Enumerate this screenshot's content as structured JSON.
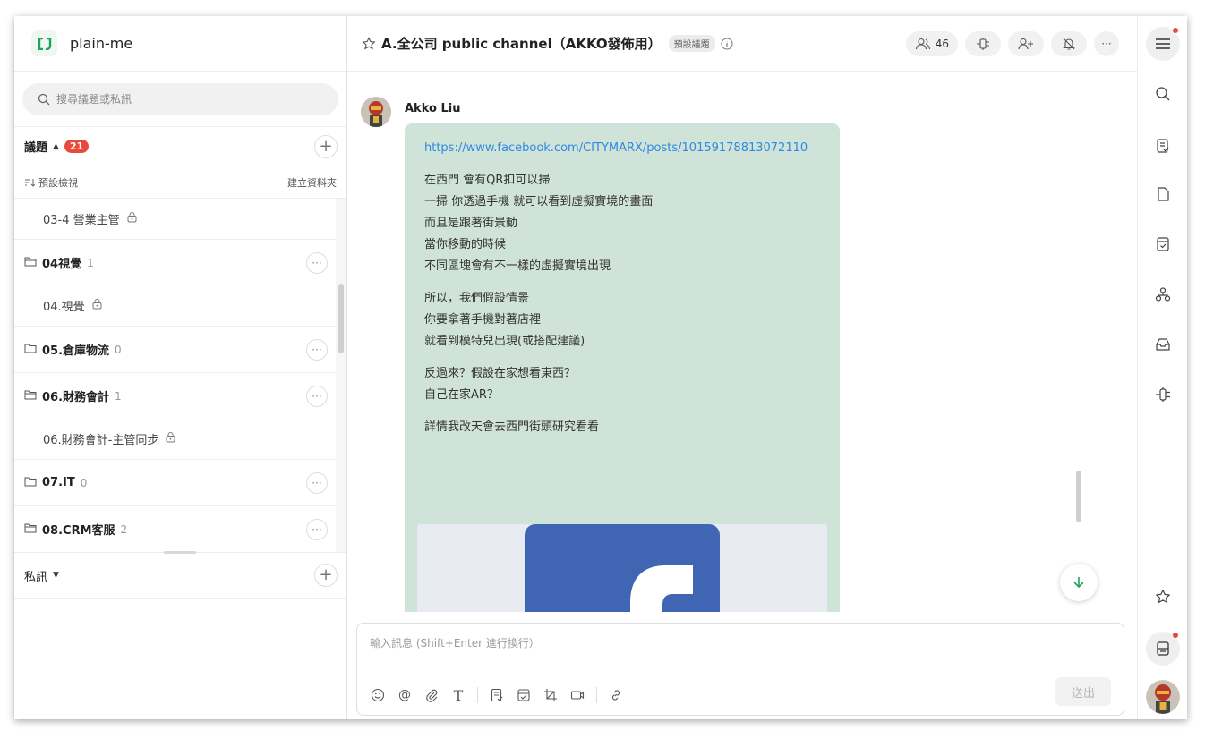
{
  "app": {
    "name": "plain-me"
  },
  "sidebar": {
    "search_placeholder": "搜尋議題或私訊",
    "topics_label": "議題",
    "topics_badge": "21",
    "view_label": "預設檢視",
    "create_folder": "建立資料夾",
    "rows": [
      {
        "type": "child",
        "name": "03-4 營業主管",
        "locked": true
      },
      {
        "type": "folder",
        "name": "04視覺",
        "count": "1",
        "open": true
      },
      {
        "type": "child",
        "name": "04.視覺",
        "locked": true
      },
      {
        "type": "folder",
        "name": "05.倉庫物流",
        "count": "0",
        "open": false
      },
      {
        "type": "folder",
        "name": "06.財務會計",
        "count": "1",
        "open": true
      },
      {
        "type": "child",
        "name": "06.財務會計-主管同步",
        "locked": true
      },
      {
        "type": "folder",
        "name": "07.IT",
        "count": "0",
        "open": false
      },
      {
        "type": "folder",
        "name": "08.CRM客服",
        "count": "2",
        "open": true
      }
    ],
    "dm_label": "私訊"
  },
  "channel": {
    "title": "A.全公司 public channel（AKKO發佈用）",
    "tag": "預設議題",
    "member_count": "46"
  },
  "message": {
    "sender": "Akko Liu",
    "link": "https://www.facebook.com/CITYMARX/posts/10159178813072110",
    "blocks": [
      [
        "在西門 會有QR扣可以掃",
        "一掃 你透過手機 就可以看到虛擬實境的畫面",
        "而且是跟著街景動",
        "當你移動的時候",
        "不同區塊會有不一樣的虛擬實境出現"
      ],
      [
        "所以，我們假設情景",
        "你要拿著手機對著店裡",
        "就看到模特兒出現(或搭配建議)"
      ],
      [
        "反過來？假設在家想看東西？",
        "自己在家AR？"
      ],
      [
        "詳情我改天會去西門街頭研究看看"
      ]
    ]
  },
  "composer": {
    "placeholder": "輸入訊息 (Shift+Enter 進行換行）",
    "send_label": "送出"
  },
  "colors": {
    "accent": "#1aa65a",
    "badge": "#ea4a3c",
    "bubble": "#cfe3d9",
    "link": "#2f8ae0"
  }
}
